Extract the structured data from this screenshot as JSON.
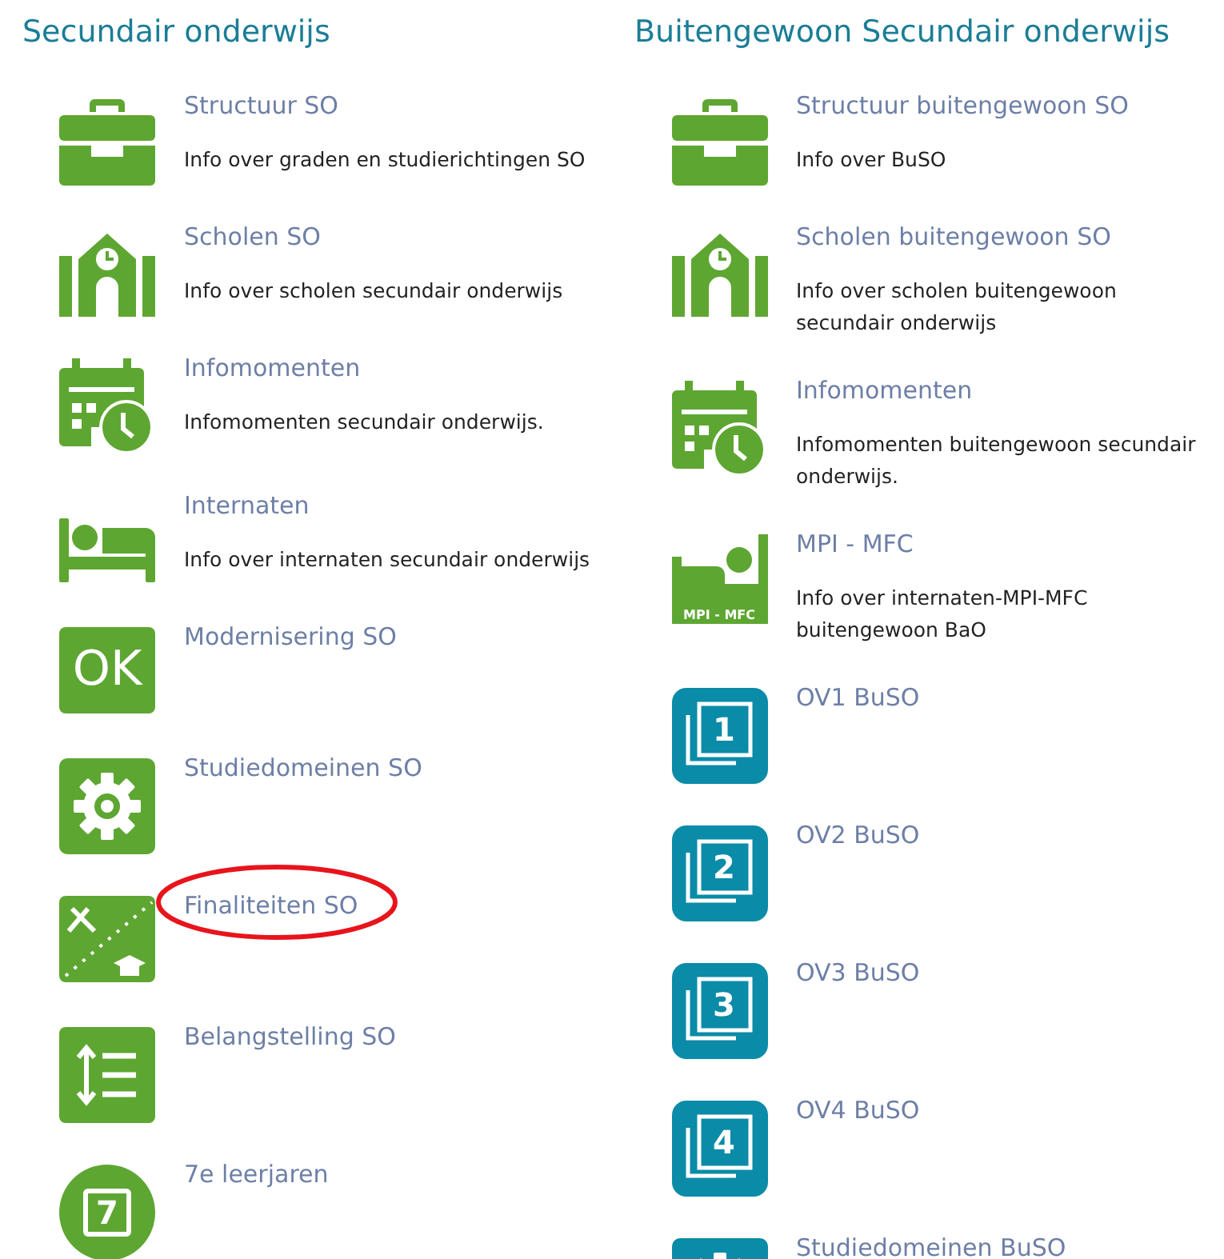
{
  "columns": [
    {
      "heading": "Secundair onderwijs",
      "items": [
        {
          "kind": "briefcase",
          "title": "Structuur SO",
          "description": "Info over graden en studierichtingen SO",
          "circled": false
        },
        {
          "kind": "school",
          "title": "Scholen SO",
          "description": "Info over scholen secundair onderwijs",
          "circled": false
        },
        {
          "kind": "calendar",
          "title": "Infomomenten",
          "description": "Infomomenten secundair onderwijs.",
          "circled": false
        },
        {
          "kind": "bed",
          "title": "Internaten",
          "description": "Info over internaten secundair onderwijs",
          "circled": false
        },
        {
          "kind": "ok",
          "icon_text": "OK",
          "title": "Modernisering SO",
          "circled": false
        },
        {
          "kind": "gear",
          "title": "Studiedomeinen SO",
          "circled": false
        },
        {
          "kind": "finality",
          "title": "Finaliteiten SO",
          "circled": true
        },
        {
          "kind": "sort",
          "title": "Belangstelling SO",
          "circled": false
        },
        {
          "kind": "year",
          "icon_text": "7",
          "title": "7e leerjaren",
          "circled": false
        }
      ]
    },
    {
      "heading": "Buitengewoon Secundair onderwijs",
      "items": [
        {
          "kind": "briefcase",
          "title": "Structuur buitengewoon SO",
          "description": "Info over BuSO",
          "circled": false
        },
        {
          "kind": "school",
          "title": "Scholen buitengewoon SO",
          "description": "Info over scholen buitengewoon secundair onderwijs",
          "circled": false
        },
        {
          "kind": "calendar",
          "title": "Infomomenten",
          "description": "Infomomenten buitengewoon secundair onderwijs.",
          "circled": false
        },
        {
          "kind": "mpi",
          "icon_text": "MPI - MFC",
          "title": "MPI - MFC",
          "description": "Info over internaten-MPI-MFC buitengewoon BaO",
          "circled": false
        },
        {
          "kind": "ov",
          "icon_text": "1",
          "title": "OV1 BuSO",
          "circled": false
        },
        {
          "kind": "ov",
          "icon_text": "2",
          "title": "OV2 BuSO",
          "circled": false
        },
        {
          "kind": "ov",
          "icon_text": "3",
          "title": "OV3 BuSO",
          "circled": false
        },
        {
          "kind": "ov",
          "icon_text": "4",
          "title": "OV4 BuSO",
          "circled": false
        },
        {
          "kind": "gear-teal",
          "title": "Studiedomeinen BuSO",
          "circled": false
        }
      ]
    }
  ]
}
